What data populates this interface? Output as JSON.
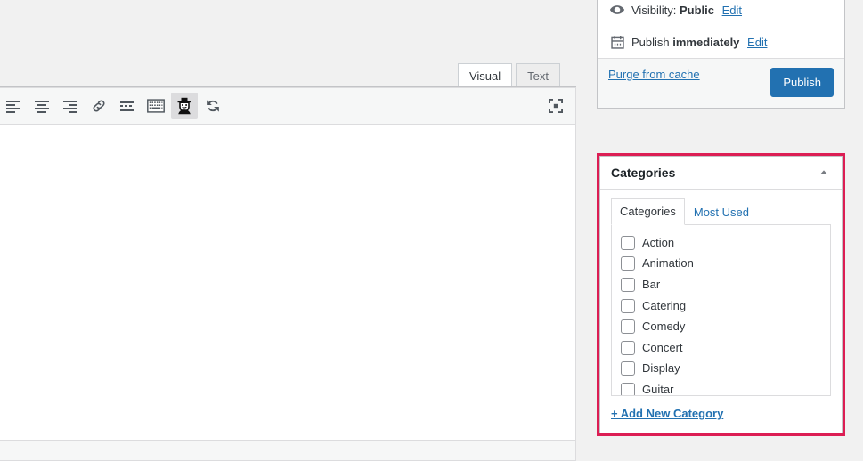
{
  "editor": {
    "tabs": [
      {
        "label": "Visual",
        "active": true
      },
      {
        "label": "Text",
        "active": false
      }
    ],
    "toolbar": [
      {
        "name": "align-left-icon",
        "title": "Align left"
      },
      {
        "name": "align-center-icon",
        "title": "Align center"
      },
      {
        "name": "align-right-icon",
        "title": "Align right"
      },
      {
        "name": "link-icon",
        "title": "Insert/edit link"
      },
      {
        "name": "insert-read-more-icon",
        "title": "Insert Read More tag"
      },
      {
        "name": "keyboard-shortcuts-icon",
        "title": "Keyboard shortcuts"
      },
      {
        "name": "incognito-spy-icon",
        "title": "Toolbar Toggle",
        "pressed": true
      },
      {
        "name": "sync-refresh-icon",
        "title": "Sync"
      }
    ],
    "fullscreen_button": {
      "name": "distraction-free-icon",
      "title": "Distraction-free writing mode"
    },
    "content": ""
  },
  "sidebar": {
    "publish_box": {
      "visibility": {
        "icon": "eye-icon",
        "prefix": "Visibility:",
        "value": "Public",
        "edit_label": "Edit"
      },
      "schedule": {
        "icon": "calendar-icon",
        "prefix": "Publish",
        "value": "immediately",
        "edit_label": "Edit"
      },
      "purge_label": "Purge from cache",
      "publish_label": "Publish",
      "publish_color": "#2271b1"
    },
    "categories_box": {
      "title": "Categories",
      "highlight_color": "#dc1e54",
      "toggle_icon": "chevron-up-icon",
      "tabs": [
        {
          "label": "Categories",
          "active": true
        },
        {
          "label": "Most Used",
          "active": false
        }
      ],
      "items": [
        {
          "label": "Action",
          "checked": false
        },
        {
          "label": "Animation",
          "checked": false
        },
        {
          "label": "Bar",
          "checked": false
        },
        {
          "label": "Catering",
          "checked": false
        },
        {
          "label": "Comedy",
          "checked": false
        },
        {
          "label": "Concert",
          "checked": false
        },
        {
          "label": "Display",
          "checked": false
        },
        {
          "label": "Guitar",
          "checked": false
        }
      ],
      "add_new_label": "+ Add New Category"
    }
  }
}
